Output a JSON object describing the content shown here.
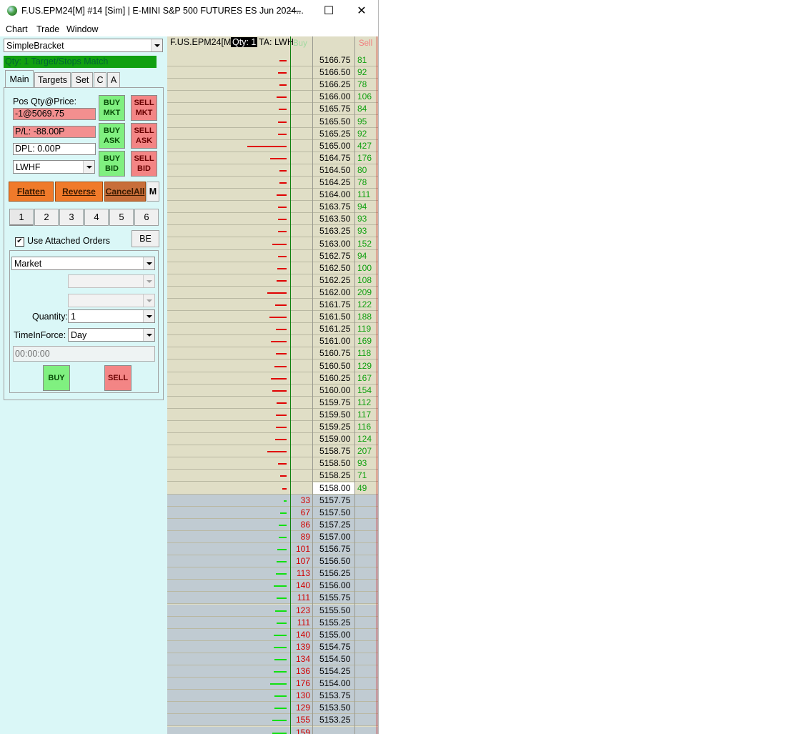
{
  "window": {
    "title": "F.US.EPM24[M] #14 [Sim]  | E-MINI S&P 500 FUTURES ES Jun 2024...",
    "minimize": "—",
    "maximize": "☐",
    "close": "✕"
  },
  "menu": [
    "Chart",
    "Trade",
    "Window"
  ],
  "panel": {
    "config_combo": "SimpleBracket",
    "status": "Qty: 1 Target/Stops Match",
    "tabs": [
      "Main",
      "Targets",
      "Set",
      "C",
      "A"
    ],
    "pos_label": "Pos Qty@Price:",
    "pos_value": "-1@5069.75",
    "pl_value": "P/L: -88.00P",
    "dpl_value": "DPL: 0.00P",
    "account_combo": "LWHF",
    "buttons": {
      "buy_mkt": [
        "BUY",
        "MKT"
      ],
      "sell_mkt": [
        "SELL",
        "MKT"
      ],
      "buy_ask": [
        "BUY",
        "ASK"
      ],
      "sell_ask": [
        "SELL",
        "ASK"
      ],
      "buy_bid": [
        "BUY",
        "BID"
      ],
      "sell_bid": [
        "SELL",
        "BID"
      ],
      "flatten": "Flatten",
      "reverse": "Reverse",
      "cancel_all": "CancelAll",
      "m": "M",
      "be": "BE",
      "buy": "BUY",
      "sell": "SELL"
    },
    "number_tabs": [
      "1",
      "2",
      "3",
      "4",
      "5",
      "6"
    ],
    "use_attached_orders": "Use Attached Orders",
    "order_type": "Market",
    "quantity_label": "Quantity:",
    "quantity_value": "1",
    "tif_label": "TimeInForce:",
    "tif_value": "Day",
    "time_value": "00:00:00"
  },
  "dom": {
    "symbol": "F.US.EPM24[M]",
    "qty_label": "Qty: 1",
    "ta_label": "TA: LWH",
    "buy_header": "Buy",
    "sell_header": "Sell",
    "last_price": "5158.00",
    "colors": {
      "ask_bg": "#e0dec6",
      "bid_bg": "#c0cbd2",
      "ask_size": "#10a010",
      "bid_size": "#d00000"
    },
    "ask_rows": [
      {
        "price": "5166.75",
        "size": "81"
      },
      {
        "price": "5166.50",
        "size": "92"
      },
      {
        "price": "5166.25",
        "size": "78"
      },
      {
        "price": "5166.00",
        "size": "106"
      },
      {
        "price": "5165.75",
        "size": "84"
      },
      {
        "price": "5165.50",
        "size": "95"
      },
      {
        "price": "5165.25",
        "size": "92"
      },
      {
        "price": "5165.00",
        "size": "427"
      },
      {
        "price": "5164.75",
        "size": "176"
      },
      {
        "price": "5164.50",
        "size": "80"
      },
      {
        "price": "5164.25",
        "size": "78"
      },
      {
        "price": "5164.00",
        "size": "111"
      },
      {
        "price": "5163.75",
        "size": "94"
      },
      {
        "price": "5163.50",
        "size": "93"
      },
      {
        "price": "5163.25",
        "size": "93"
      },
      {
        "price": "5163.00",
        "size": "152"
      },
      {
        "price": "5162.75",
        "size": "94"
      },
      {
        "price": "5162.50",
        "size": "100"
      },
      {
        "price": "5162.25",
        "size": "108"
      },
      {
        "price": "5162.00",
        "size": "209"
      },
      {
        "price": "5161.75",
        "size": "122"
      },
      {
        "price": "5161.50",
        "size": "188"
      },
      {
        "price": "5161.25",
        "size": "119"
      },
      {
        "price": "5161.00",
        "size": "169"
      },
      {
        "price": "5160.75",
        "size": "118"
      },
      {
        "price": "5160.50",
        "size": "129"
      },
      {
        "price": "5160.25",
        "size": "167"
      },
      {
        "price": "5160.00",
        "size": "154"
      },
      {
        "price": "5159.75",
        "size": "112"
      },
      {
        "price": "5159.50",
        "size": "117"
      },
      {
        "price": "5159.25",
        "size": "116"
      },
      {
        "price": "5159.00",
        "size": "124"
      },
      {
        "price": "5158.75",
        "size": "207"
      },
      {
        "price": "5158.50",
        "size": "93"
      },
      {
        "price": "5158.25",
        "size": "71"
      },
      {
        "price": "5158.00",
        "size": "49"
      }
    ],
    "bid_rows": [
      {
        "price": "5157.75",
        "size": "33"
      },
      {
        "price": "5157.50",
        "size": "67"
      },
      {
        "price": "5157.25",
        "size": "86"
      },
      {
        "price": "5157.00",
        "size": "89"
      },
      {
        "price": "5156.75",
        "size": "101"
      },
      {
        "price": "5156.50",
        "size": "107"
      },
      {
        "price": "5156.25",
        "size": "113"
      },
      {
        "price": "5156.00",
        "size": "140"
      },
      {
        "price": "5155.75",
        "size": "111"
      },
      {
        "price": "5155.50",
        "size": "123"
      },
      {
        "price": "5155.25",
        "size": "111"
      },
      {
        "price": "5155.00",
        "size": "140"
      },
      {
        "price": "5154.75",
        "size": "139"
      },
      {
        "price": "5154.50",
        "size": "134"
      },
      {
        "price": "5154.25",
        "size": "136"
      },
      {
        "price": "5154.00",
        "size": "176"
      },
      {
        "price": "5153.75",
        "size": "130"
      },
      {
        "price": "5153.50",
        "size": "129"
      },
      {
        "price": "5153.25",
        "size": "155"
      },
      {
        "price": "",
        "size": "159"
      }
    ]
  }
}
